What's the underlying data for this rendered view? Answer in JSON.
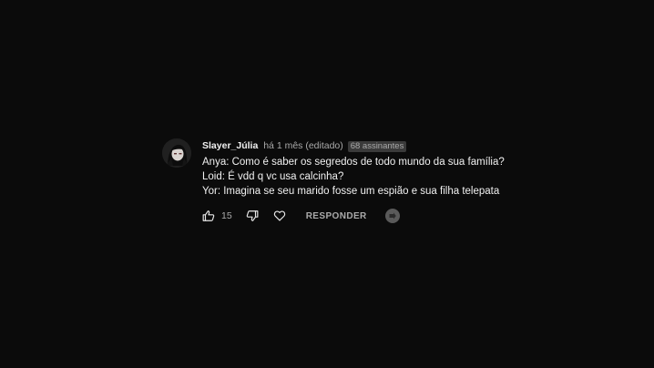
{
  "comment": {
    "author": "Slayer_Júlia",
    "time": "há 1 mês (editado)",
    "subscribers_badge": "68 assinantes",
    "lines": [
      "Anya: Como é saber os segredos de todo mundo da sua família?",
      "Loid: É vdd q vc usa calcinha?",
      "Yor: Imagina se seu marido fosse um espião e sua filha telepata"
    ],
    "like_count": "15",
    "reply_label": "RESPONDER"
  },
  "icons": {
    "avatar": "avatar-anime-girl",
    "like": "thumbs-up-icon",
    "dislike": "thumbs-down-icon",
    "heart": "heart-icon",
    "creator": "creator-badge-icon"
  },
  "colors": {
    "background": "#0b0b0b",
    "text": "#f1f1f1",
    "secondary_text": "#aaaaaa",
    "badge_bg": "#3a3a3a"
  }
}
